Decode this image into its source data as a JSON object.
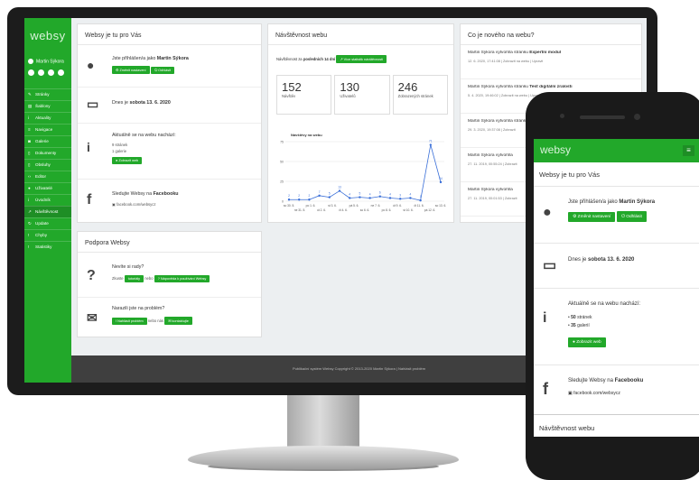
{
  "sidebar": {
    "logo": "websy",
    "user": "Martin Sýkora",
    "items": [
      "Stránky",
      "Šablony",
      "Aktuality",
      "Navigace",
      "Galerie",
      "Dokumenty",
      "Obsluhy",
      "Editor",
      "Uživatelé",
      "Úvodník",
      "Návštěvnost",
      "Update",
      "Chyby",
      "Statistiky"
    ]
  },
  "welcome": {
    "title": "Websy je tu pro Vás",
    "logged_as": "Jste přihlášen/a jako",
    "user": "Martin Sýkora",
    "btn_settings": "Změnit nastavení",
    "btn_logout": "Odhlásit",
    "today_prefix": "Dnes je",
    "today": "sobota 13. 6. 2020",
    "now_prefix": "Aktuálně se na webu nachází:",
    "pages": "9 stránek",
    "galleries": "1 galerie",
    "btn_show": "Zobrazit web",
    "fb_prefix": "Sledujte Websy na",
    "fb_name": "Facebooku",
    "fb_link": "facebook.com/websycz"
  },
  "visits": {
    "title": "Návštěvnost webu",
    "subtitle_a": "Návštěvnost za",
    "subtitle_b": "posledních 14 dní",
    "btn": "Více statistik návštěvnosti",
    "stat1_val": "152",
    "stat1_label": "Návštěv",
    "stat2_val": "130",
    "stat2_label": "Uživatelů",
    "stat3_val": "246",
    "stat3_label": "Zobrazených stránek"
  },
  "chart_data": {
    "type": "line",
    "title": "Návštěvy na webu",
    "x": [
      "so 30. 5.",
      "ne 31. 5.",
      "po 1. 6.",
      "út 2. 6.",
      "st 3. 6.",
      "čt 4. 6.",
      "pá 5. 6.",
      "so 6. 6.",
      "ne 7. 6.",
      "po 8. 6.",
      "út 9. 6.",
      "st 10. 6.",
      "čt 11. 6.",
      "pá 12. 6.",
      "so 13. 6."
    ],
    "values": [
      2,
      2,
      2,
      7,
      5,
      13,
      4,
      5,
      4,
      6,
      4,
      3,
      4,
      1,
      71,
      24
    ],
    "ylim": [
      0,
      75
    ],
    "yticks": [
      0,
      25,
      50,
      75
    ],
    "color": "#3a6fd8"
  },
  "news": {
    "title": "Co je nového na webu?",
    "items": [
      {
        "text_a": "Martin Sýkora vytvořil/a stránku",
        "bold": "Expertní modul",
        "meta": "12. 6. 2020, 17:41:08 | Zobrazit na webu | Upravit"
      },
      {
        "text_a": "Martin Sýkora vytvořil/a stránku",
        "bold": "Test digitální zralosti",
        "meta": "5. 4. 2020, 19:46:02 | Zobrazit na webu | Upravit"
      },
      {
        "text_a": "Martin Sýkora vytvořil/a stránku",
        "bold": "Služby",
        "meta": "29. 3. 2020, 19:37:08 | Zobrazit"
      },
      {
        "text_a": "Martin Sýkora vytvořil/a",
        "bold": "",
        "meta": "27. 11. 2019, 00:55:24 | Zobrazit"
      },
      {
        "text_a": "Martin Sýkora vytvořil/a",
        "bold": "",
        "meta": "27. 11. 2019, 00:01:53 | Zobrazit"
      }
    ]
  },
  "support": {
    "title": "Podpora Websy",
    "q1": "Nevíte si rady?",
    "q1_a": "Zkuste",
    "q1_btn1": "tutoriály",
    "q1_b": "nebo",
    "q1_btn2": "Nápověda k používání Websy",
    "q2": "Narazili jste na problém?",
    "q2_btn1": "Nahlásit problém",
    "q2_b": "nebo nás",
    "q2_btn2": "kontaktujte"
  },
  "footer": "Publikační systém Websy Copyright © 2013-2020 Martin Sýkora | Nahlásit problém",
  "phone": {
    "logo": "websy",
    "title": "Websy je tu pro Vás",
    "logged_as": "Jste přihlášen/a jako",
    "user": "Martin Sýkora",
    "btn_settings": "Změnit nastavení",
    "btn_logout": "Odhlásit",
    "today_prefix": "Dnes je",
    "today": "sobota 13. 6. 2020",
    "now_prefix": "Aktuálně se na webu nachází:",
    "pages_num": "50",
    "pages_label": "stránek",
    "gal_num": "35",
    "gal_label": "galerií",
    "btn_show": "Zobrazit web",
    "fb_prefix": "Sledujte Websy na",
    "fb_name": "Facebooku",
    "fb_link": "facebook.com/websycz",
    "visits_title": "Návštěvnost webu"
  }
}
